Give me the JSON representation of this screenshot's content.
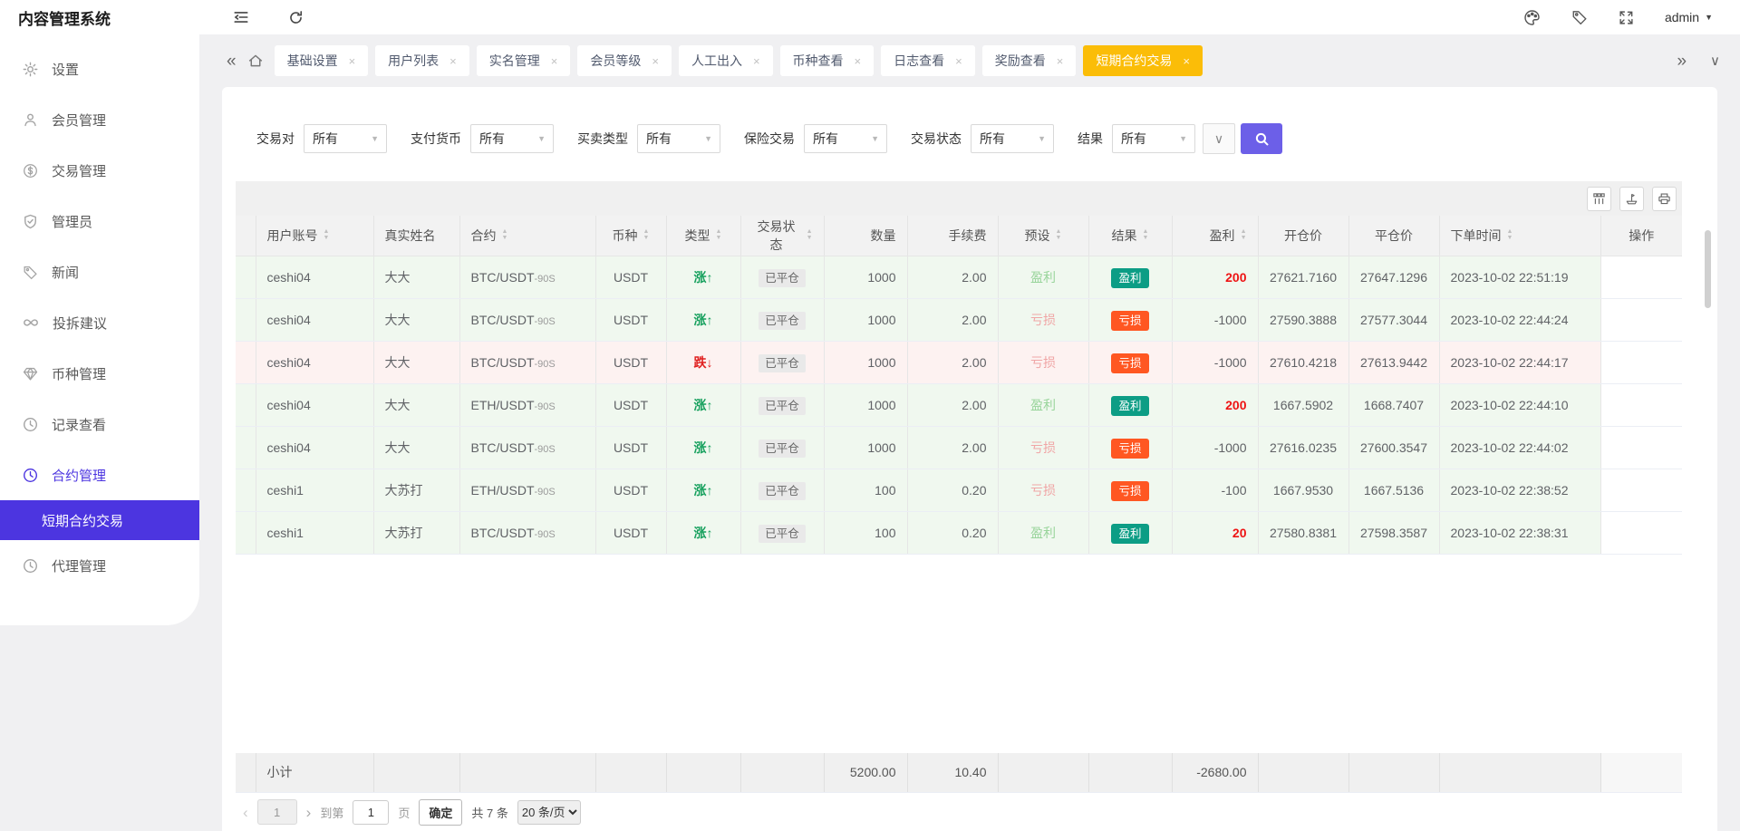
{
  "app": {
    "title": "内容管理系统",
    "user": "admin"
  },
  "header_icons": [
    "collapse-menu",
    "refresh",
    "palette",
    "tag",
    "fullscreen",
    "caret-down"
  ],
  "tabs": {
    "items": [
      "基础设置",
      "用户列表",
      "实名管理",
      "会员等级",
      "人工出入",
      "币种查看",
      "日志查看",
      "奖励查看",
      "短期合约交易"
    ],
    "active_index": 8,
    "active_color": "#fbbd08"
  },
  "sidebar": {
    "items": [
      {
        "label": "设置",
        "icon": "gear"
      },
      {
        "label": "会员管理",
        "icon": "user"
      },
      {
        "label": "交易管理",
        "icon": "dollar-circle"
      },
      {
        "label": "管理员",
        "icon": "shield-check"
      },
      {
        "label": "新闻",
        "icon": "tag"
      },
      {
        "label": "投拆建议",
        "icon": "infinity"
      },
      {
        "label": "币种管理",
        "icon": "gem"
      },
      {
        "label": "记录查看",
        "icon": "clock"
      },
      {
        "label": "合约管理",
        "icon": "clock"
      }
    ],
    "submenu_label": "短期合约交易",
    "agent_label": "代理管理",
    "active_color": "#4c35e0"
  },
  "filters": {
    "items": [
      {
        "label": "交易对",
        "value": "所有"
      },
      {
        "label": "支付货币",
        "value": "所有"
      },
      {
        "label": "买卖类型",
        "value": "所有"
      },
      {
        "label": "保险交易",
        "value": "所有"
      },
      {
        "label": "交易状态",
        "value": "所有"
      },
      {
        "label": "结果",
        "value": "所有"
      }
    ],
    "search_button_color": "#6c5fe8"
  },
  "toolbar_icons": [
    "columns",
    "export",
    "print"
  ],
  "table": {
    "columns": [
      {
        "label": "",
        "sortable": false
      },
      {
        "label": "用户账号",
        "sortable": true
      },
      {
        "label": "真实姓名",
        "sortable": false
      },
      {
        "label": "合约",
        "sortable": true
      },
      {
        "label": "币种",
        "sortable": true
      },
      {
        "label": "类型",
        "sortable": true
      },
      {
        "label": "交易状态",
        "sortable": true
      },
      {
        "label": "数量",
        "sortable": false
      },
      {
        "label": "手续费",
        "sortable": false
      },
      {
        "label": "预设",
        "sortable": true
      },
      {
        "label": "结果",
        "sortable": true
      },
      {
        "label": "盈利",
        "sortable": true
      },
      {
        "label": "开仓价",
        "sortable": false
      },
      {
        "label": "平仓价",
        "sortable": false
      },
      {
        "label": "下单时间",
        "sortable": true
      },
      {
        "label": "操作",
        "sortable": false
      }
    ],
    "rows": [
      {
        "account": "ceshi04",
        "real_name": "大大",
        "contract": "BTC/USDT",
        "contract_suffix": "-90S",
        "coin": "USDT",
        "type": "涨",
        "direction": "up",
        "status": "已平仓",
        "amount": "1000",
        "fee": "2.00",
        "preset": "盈利",
        "result": "盈利",
        "profit": "200",
        "open_price": "27621.7160",
        "close_price": "27647.1296",
        "time": "2023-10-02 22:51:19"
      },
      {
        "account": "ceshi04",
        "real_name": "大大",
        "contract": "BTC/USDT",
        "contract_suffix": "-90S",
        "coin": "USDT",
        "type": "涨",
        "direction": "up",
        "status": "已平仓",
        "amount": "1000",
        "fee": "2.00",
        "preset": "亏损",
        "result": "亏损",
        "profit": "-1000",
        "open_price": "27590.3888",
        "close_price": "27577.3044",
        "time": "2023-10-02 22:44:24"
      },
      {
        "account": "ceshi04",
        "real_name": "大大",
        "contract": "BTC/USDT",
        "contract_suffix": "-90S",
        "coin": "USDT",
        "type": "跌",
        "direction": "down",
        "status": "已平仓",
        "amount": "1000",
        "fee": "2.00",
        "preset": "亏损",
        "result": "亏损",
        "profit": "-1000",
        "open_price": "27610.4218",
        "close_price": "27613.9442",
        "time": "2023-10-02 22:44:17"
      },
      {
        "account": "ceshi04",
        "real_name": "大大",
        "contract": "ETH/USDT",
        "contract_suffix": "-90S",
        "coin": "USDT",
        "type": "涨",
        "direction": "up",
        "status": "已平仓",
        "amount": "1000",
        "fee": "2.00",
        "preset": "盈利",
        "result": "盈利",
        "profit": "200",
        "open_price": "1667.5902",
        "close_price": "1668.7407",
        "time": "2023-10-02 22:44:10"
      },
      {
        "account": "ceshi04",
        "real_name": "大大",
        "contract": "BTC/USDT",
        "contract_suffix": "-90S",
        "coin": "USDT",
        "type": "涨",
        "direction": "up",
        "status": "已平仓",
        "amount": "1000",
        "fee": "2.00",
        "preset": "亏损",
        "result": "亏损",
        "profit": "-1000",
        "open_price": "27616.0235",
        "close_price": "27600.3547",
        "time": "2023-10-02 22:44:02"
      },
      {
        "account": "ceshi1",
        "real_name": "大苏打",
        "contract": "ETH/USDT",
        "contract_suffix": "-90S",
        "coin": "USDT",
        "type": "涨",
        "direction": "up",
        "status": "已平仓",
        "amount": "100",
        "fee": "0.20",
        "preset": "亏损",
        "result": "亏损",
        "profit": "-100",
        "open_price": "1667.9530",
        "close_price": "1667.5136",
        "time": "2023-10-02 22:38:52"
      },
      {
        "account": "ceshi1",
        "real_name": "大苏打",
        "contract": "BTC/USDT",
        "contract_suffix": "-90S",
        "coin": "USDT",
        "type": "涨",
        "direction": "up",
        "status": "已平仓",
        "amount": "100",
        "fee": "0.20",
        "preset": "盈利",
        "result": "盈利",
        "profit": "20",
        "open_price": "27580.8381",
        "close_price": "27598.3587",
        "time": "2023-10-02 22:38:31"
      }
    ],
    "summary": {
      "label": "小计",
      "amount": "5200.00",
      "fee": "10.40",
      "profit": "-2680.00"
    },
    "colors": {
      "result_win": "#0c9d85",
      "result_loss": "#ff5722",
      "type_up": "#16a05d",
      "type_down": "#e02020",
      "profit_positive": "#ee1414",
      "row_up_tint": "#f0f8ef",
      "row_down_tint": "#fdf2f1"
    }
  },
  "pagination": {
    "current_page": "1",
    "goto_label": "到第",
    "goto_page": "1",
    "page_unit": "页",
    "confirm_label": "确定",
    "total_text": "共 7 条",
    "page_size_option": "20 条/页"
  }
}
